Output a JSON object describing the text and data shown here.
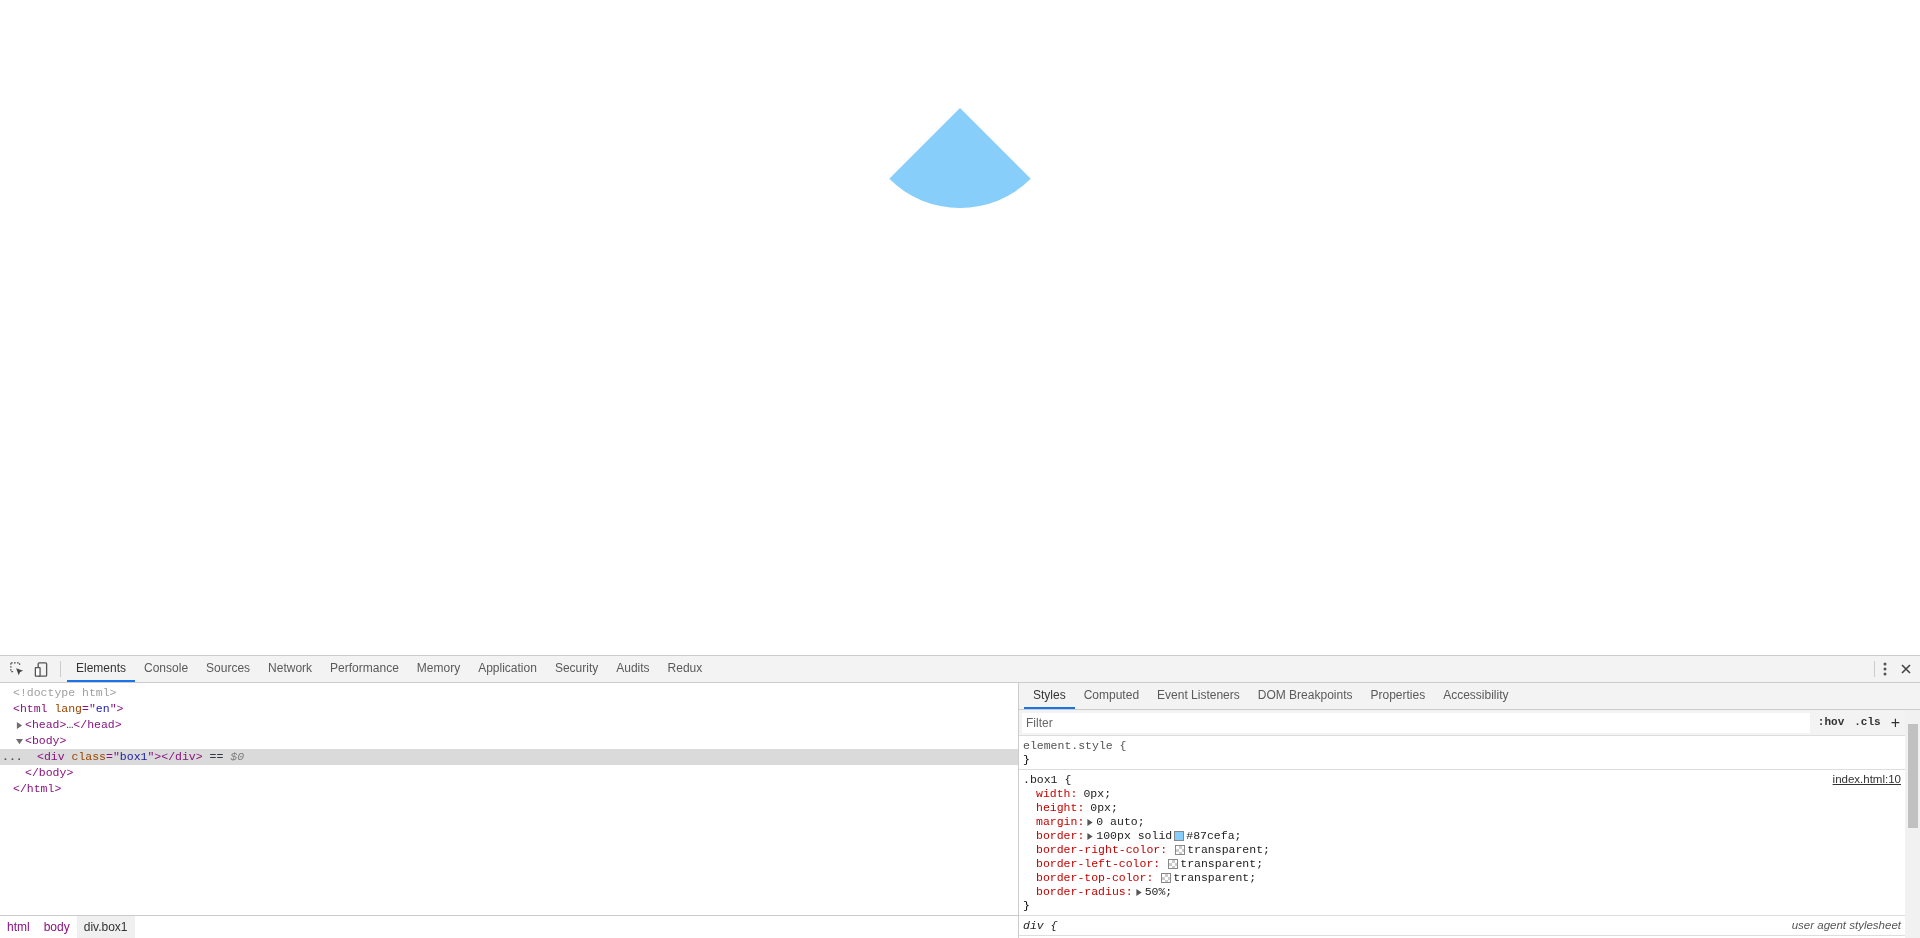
{
  "page": {
    "shape": {
      "kind": "sector",
      "color": "#87cefa"
    }
  },
  "devtools": {
    "tabs": [
      {
        "label": "Elements",
        "selected": true
      },
      {
        "label": "Console",
        "selected": false
      },
      {
        "label": "Sources",
        "selected": false
      },
      {
        "label": "Network",
        "selected": false
      },
      {
        "label": "Performance",
        "selected": false
      },
      {
        "label": "Memory",
        "selected": false
      },
      {
        "label": "Application",
        "selected": false
      },
      {
        "label": "Security",
        "selected": false
      },
      {
        "label": "Audits",
        "selected": false
      },
      {
        "label": "Redux",
        "selected": false
      }
    ],
    "dom_tree": [
      {
        "selected": false,
        "tokens": [
          {
            "kind": "comment",
            "text": "<!doctype html>"
          }
        ]
      },
      {
        "selected": false,
        "tokens": [
          {
            "kind": "tag",
            "text": "<html"
          },
          {
            "kind": "attr",
            "text": " lang"
          },
          {
            "kind": "tag",
            "text": "=\""
          },
          {
            "kind": "value",
            "text": "en"
          },
          {
            "kind": "tag",
            "text": "\">"
          }
        ],
        "children": [
          {
            "selected": false,
            "expanded": false,
            "tokens": [
              {
                "kind": "tag",
                "text": "<head>"
              },
              {
                "kind": "plain",
                "text": "…"
              },
              {
                "kind": "tag",
                "text": "</head>"
              }
            ]
          },
          {
            "selected": false,
            "expanded": true,
            "tokens": [
              {
                "kind": "tag",
                "text": "<body>"
              }
            ],
            "children": [
              {
                "selected": true,
                "marker": "...",
                "tokens": [
                  {
                    "kind": "tag",
                    "text": "<div"
                  },
                  {
                    "kind": "attr",
                    "text": " class"
                  },
                  {
                    "kind": "tag",
                    "text": "=\""
                  },
                  {
                    "kind": "value",
                    "text": "box1"
                  },
                  {
                    "kind": "tag",
                    "text": "\">"
                  },
                  {
                    "kind": "tag",
                    "text": "</div>"
                  },
                  {
                    "kind": "plain",
                    "text": " == "
                  },
                  {
                    "kind": "ref",
                    "text": "$0"
                  }
                ]
              }
            ],
            "closing": [
              {
                "kind": "tag",
                "text": "</body>"
              }
            ]
          }
        ],
        "closing": [
          {
            "kind": "tag",
            "text": "</html>"
          }
        ]
      }
    ],
    "breadcrumbs": [
      {
        "label": "html",
        "selected": false
      },
      {
        "label": "body",
        "selected": false
      },
      {
        "label": "div.box1",
        "selected": true
      }
    ],
    "side_tabs": [
      {
        "label": "Styles",
        "selected": true
      },
      {
        "label": "Computed",
        "selected": false
      },
      {
        "label": "Event Listeners",
        "selected": false
      },
      {
        "label": "DOM Breakpoints",
        "selected": false
      },
      {
        "label": "Properties",
        "selected": false
      },
      {
        "label": "Accessibility",
        "selected": false
      }
    ],
    "filter": {
      "placeholder": "Filter"
    },
    "filter_buttons": [
      ":hov",
      ".cls",
      "+"
    ],
    "rules": [
      {
        "kind": "inline",
        "selector": "element.style {",
        "closing": "}"
      },
      {
        "kind": "author",
        "selector": ".box1 {",
        "source": "index.html:10",
        "closing": "}",
        "declarations": [
          {
            "name": "width:",
            "value": "0px;",
            "expandable": false
          },
          {
            "name": "height:",
            "value": "0px;",
            "expandable": false
          },
          {
            "name": "margin:",
            "value": "0 auto;",
            "expandable": true
          },
          {
            "name": "border:",
            "value": "100px solid",
            "swatch": {
              "kind": "color",
              "color": "#87cefa"
            },
            "after": "#87cefa;",
            "expandable": true
          },
          {
            "name": "border-right-color:",
            "swatch": {
              "kind": "transparent"
            },
            "after": "transparent;",
            "expandable": false
          },
          {
            "name": "border-left-color:",
            "swatch": {
              "kind": "transparent"
            },
            "after": "transparent;",
            "expandable": false
          },
          {
            "name": "border-top-color:",
            "swatch": {
              "kind": "transparent"
            },
            "after": "transparent;",
            "expandable": false
          },
          {
            "name": "border-radius:",
            "value": "50%;",
            "expandable": true
          }
        ]
      },
      {
        "kind": "user_agent",
        "selector": "div {",
        "source": "user agent stylesheet"
      }
    ]
  }
}
